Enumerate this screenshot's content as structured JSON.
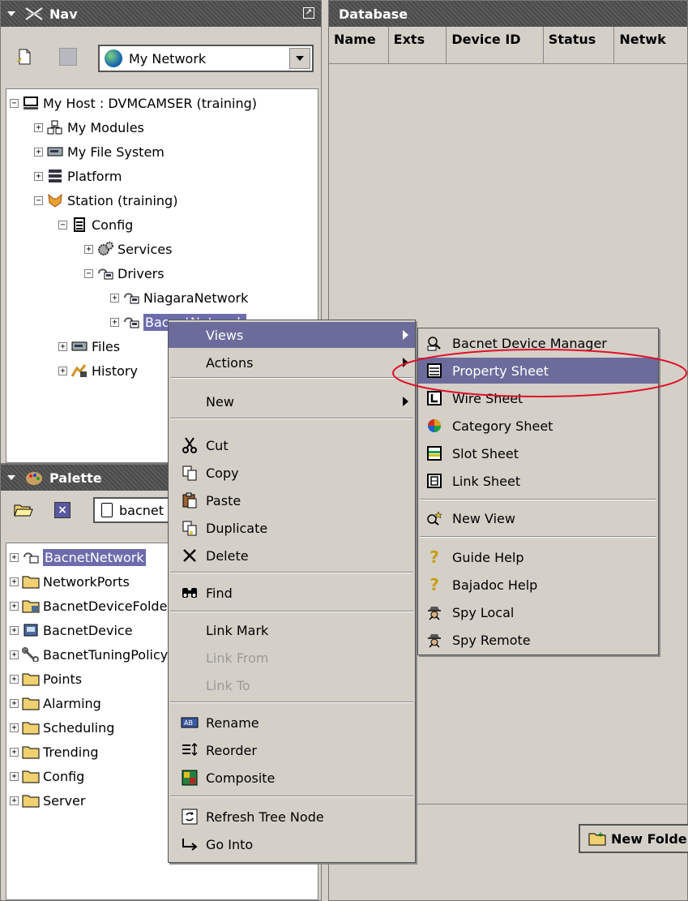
{
  "nav": {
    "title": "Nav",
    "network_select": "My Network",
    "tree": [
      {
        "label": "My Host : DVMCAMSER (training)",
        "toggle": "−",
        "icon": "host-icon"
      },
      {
        "label": "My Modules",
        "toggle": "+",
        "icon": "modules-icon"
      },
      {
        "label": "My File System",
        "toggle": "+",
        "icon": "drive-icon"
      },
      {
        "label": "Platform",
        "toggle": "+",
        "icon": "platform-icon"
      },
      {
        "label": "Station (training)",
        "toggle": "−",
        "icon": "station-icon"
      },
      {
        "label": "Config",
        "toggle": "−",
        "icon": "config-icon"
      },
      {
        "label": "Services",
        "toggle": "+",
        "icon": "gears-icon"
      },
      {
        "label": "Drivers",
        "toggle": "−",
        "icon": "network-icon"
      },
      {
        "label": "NiagaraNetwork",
        "toggle": "+",
        "icon": "network-icon"
      },
      {
        "label": "BacnetNetwork",
        "toggle": "+",
        "icon": "network-icon"
      },
      {
        "label": "Files",
        "toggle": "+",
        "icon": "drive-icon"
      },
      {
        "label": "History",
        "toggle": "+",
        "icon": "history-icon"
      }
    ]
  },
  "palette": {
    "title": "Palette",
    "module_select": "bacnet",
    "items": [
      {
        "label": "BacnetNetwork",
        "icon": "network-icon"
      },
      {
        "label": "NetworkPorts",
        "icon": "folder-icon"
      },
      {
        "label": "BacnetDeviceFolder",
        "icon": "device-folder-icon"
      },
      {
        "label": "BacnetDevice",
        "icon": "device-icon"
      },
      {
        "label": "BacnetTuningPolicy",
        "icon": "wrench-icon"
      },
      {
        "label": "Points",
        "icon": "folder-icon"
      },
      {
        "label": "Alarming",
        "icon": "folder-icon"
      },
      {
        "label": "Scheduling",
        "icon": "folder-icon"
      },
      {
        "label": "Trending",
        "icon": "folder-icon"
      },
      {
        "label": "Config",
        "icon": "folder-icon"
      },
      {
        "label": "Server",
        "icon": "folder-icon"
      }
    ]
  },
  "database": {
    "title": "Database",
    "columns": [
      "Name",
      "Exts",
      "Device ID",
      "Status",
      "Netwk"
    ],
    "new_folder_button": "New Folder"
  },
  "context_menu": {
    "items": [
      "Views",
      "Actions",
      "New",
      "Cut",
      "Copy",
      "Paste",
      "Duplicate",
      "Delete",
      "Find",
      "Link Mark",
      "Link From",
      "Link To",
      "Rename",
      "Reorder",
      "Composite",
      "Refresh Tree Node",
      "Go Into"
    ]
  },
  "views_submenu": {
    "items": [
      "Bacnet Device Manager",
      "Property Sheet",
      "Wire Sheet",
      "Category Sheet",
      "Slot Sheet",
      "Link Sheet",
      "New View",
      "Guide Help",
      "Bajadoc Help",
      "Spy Local",
      "Spy Remote"
    ],
    "highlight_color": "#e0102a"
  },
  "colors": {
    "selection": "#6c6cac",
    "menu_highlight": "#6c6c9c",
    "annotation": "#e0102a"
  }
}
